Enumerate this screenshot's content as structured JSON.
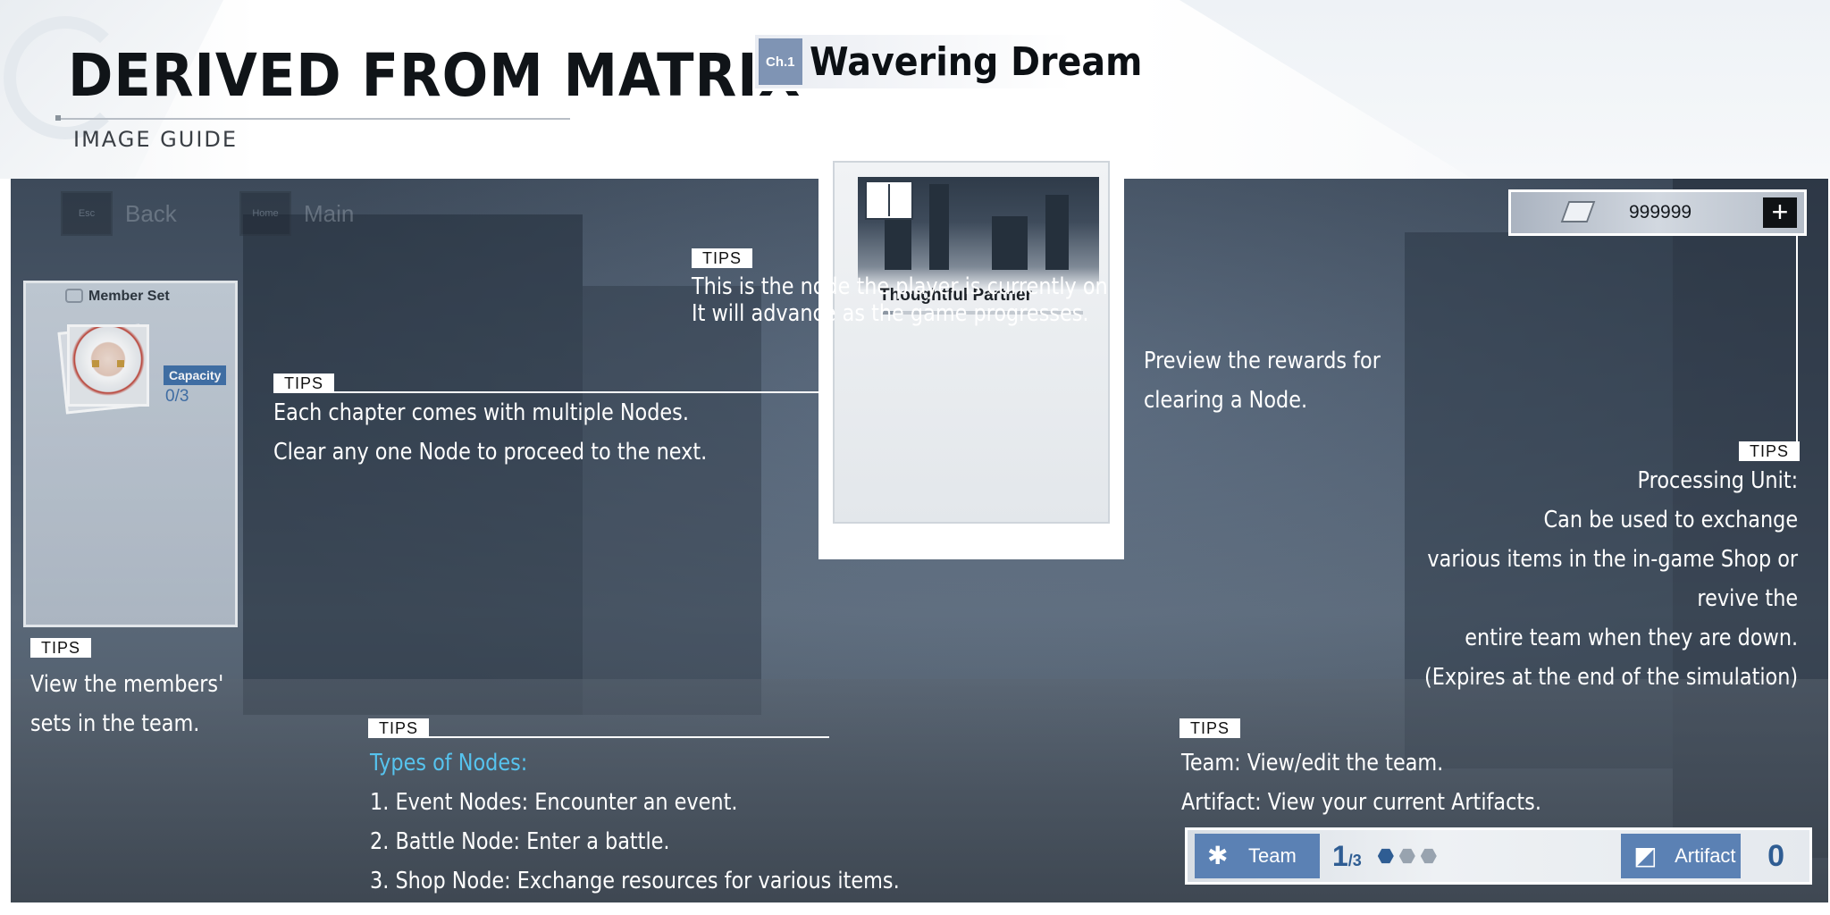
{
  "header": {
    "title": "DERIVED FROM MATRIX",
    "subtitle": "IMAGE GUIDE"
  },
  "game": {
    "keys": [
      {
        "key": "Esc",
        "label": "Back"
      },
      {
        "key": "Home",
        "label": "Main"
      }
    ],
    "chapter": {
      "tag": "Ch.1",
      "name": "Wavering Dream"
    },
    "currency": {
      "value": "999999",
      "plus": "+"
    },
    "member_set": {
      "title": "Member Set",
      "capacity_label": "Capacity",
      "capacity_value": "0/3"
    },
    "node": {
      "label": "Thoughtful Partner",
      "progress": 0.06
    },
    "team_bar": {
      "team_label": "Team",
      "team_count": "1",
      "team_total": "/3",
      "slots_filled": 1,
      "slots_total": 3,
      "artifact_label": "Artifact",
      "artifact_count": "0"
    }
  },
  "tips": {
    "tag": "TIPS",
    "current_node": [
      "This is the node the player is currently on.",
      "It will advance as the game progresses."
    ],
    "chapter_nodes": [
      "Each chapter comes with multiple Nodes.",
      "Clear any one Node to proceed to the next."
    ],
    "rewards": [
      "Preview the rewards for",
      "clearing a Node."
    ],
    "processing_unit": [
      "Processing Unit:",
      "Can be used to exchange",
      "various items in the in-game Shop or",
      "revive the",
      "entire team when they are down.",
      "(Expires at the end of the simulation)"
    ],
    "members": [
      "View the members'",
      "sets in the team."
    ],
    "node_types": {
      "heading": "Types of Nodes:",
      "items": [
        "1. Event Nodes: Encounter an event.",
        "2. Battle Node: Enter a battle.",
        "3. Shop Node: Exchange resources for various items."
      ]
    },
    "team": [
      "Team: View/edit the team.",
      "Artifact: View your current Artifacts."
    ]
  },
  "colors": {
    "accent_blue": "#5b81b4",
    "tips_heading": "#56c3ee",
    "panel_dark": "#3d4a5a"
  },
  "icons": [
    "esc-key-icon",
    "home-key-icon",
    "processing-unit-icon",
    "plus-icon",
    "book-icon",
    "team-icon",
    "artifact-icon",
    "member-set-icon"
  ]
}
